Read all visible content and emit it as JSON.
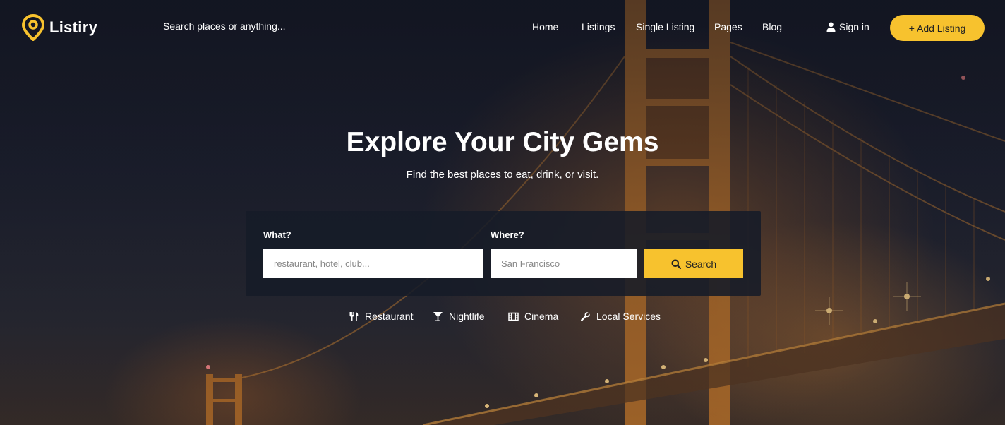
{
  "brand": {
    "name": "Listiry",
    "accent": "#f7c22e"
  },
  "header": {
    "search_placeholder": "Search places or anything...",
    "nav": [
      "Home",
      "Listings",
      "Single Listing",
      "Pages",
      "Blog"
    ],
    "sign_in": "Sign in",
    "add_listing": "+ Add Listing"
  },
  "hero": {
    "title": "Explore Your City Gems",
    "subtitle": "Find the best places to eat, drink, or visit."
  },
  "search": {
    "what_label": "What?",
    "what_placeholder": "restaurant, hotel, club...",
    "where_label": "Where?",
    "where_placeholder": "San Francisco",
    "button": "Search"
  },
  "categories": [
    {
      "label": "Restaurant",
      "icon": "fork-knife-icon"
    },
    {
      "label": "Nightlife",
      "icon": "cocktail-icon"
    },
    {
      "label": "Cinema",
      "icon": "film-icon"
    },
    {
      "label": "Local Services",
      "icon": "wrench-icon"
    }
  ]
}
